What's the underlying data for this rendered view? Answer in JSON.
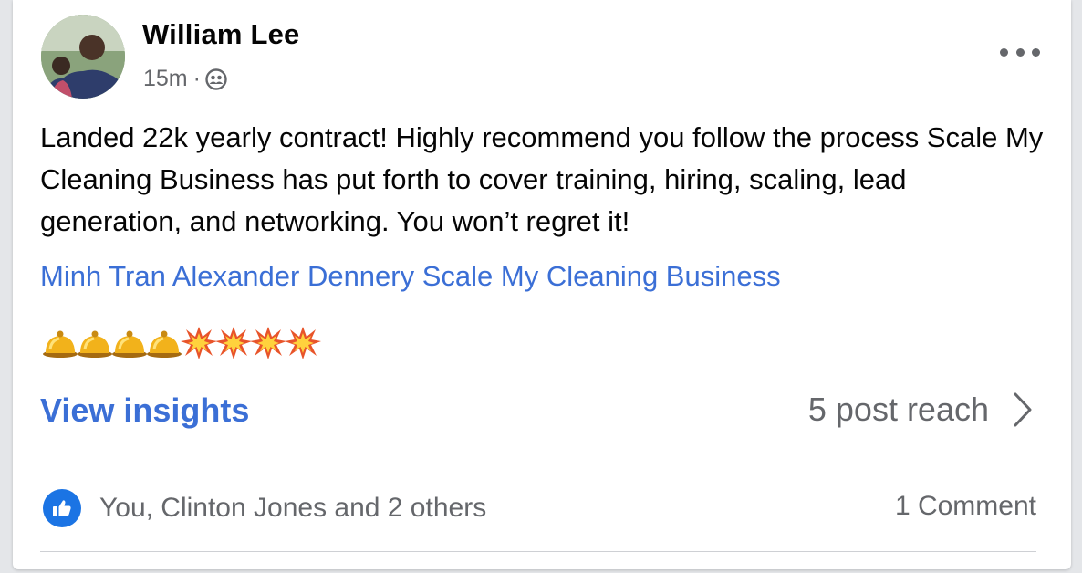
{
  "post": {
    "author": "William Lee",
    "time": "15m",
    "separator": "·",
    "audience_icon": "friends-icon",
    "text": "Landed 22k yearly contract! Highly recommend you follow the process Scale My Cleaning Business has put forth to cover training, hiring, scaling, lead generation, and networking. You won’t regret it!",
    "tags": "Minh Tran Alexander Dennery Scale My Cleaning Business",
    "emojis": [
      "bell",
      "bell",
      "bell",
      "bell",
      "collision",
      "collision",
      "collision",
      "collision"
    ]
  },
  "insights": {
    "label": "View insights",
    "reach": "5 post reach"
  },
  "reactions": {
    "icon": "like-icon",
    "summary": "You, Clinton Jones and 2 others",
    "comments": "1 Comment"
  },
  "colors": {
    "link": "#3b6fd6",
    "like": "#1b74e4",
    "secondary_text": "#65676b"
  }
}
